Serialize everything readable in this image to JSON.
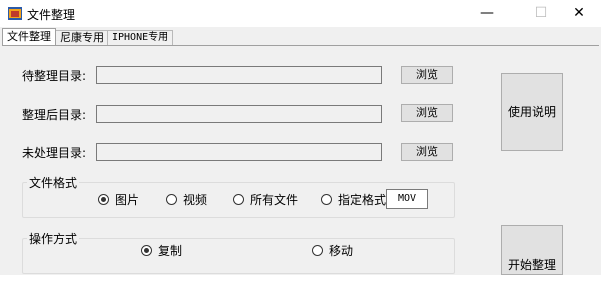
{
  "window": {
    "title": "文件整理",
    "controls": {
      "minimize": "—",
      "maximize": "☐",
      "close": "✕"
    }
  },
  "tabs": [
    {
      "label": "文件整理",
      "active": true
    },
    {
      "label": "尼康专用",
      "active": false
    },
    {
      "label": "IPHONE专用",
      "active": false
    }
  ],
  "dirs": {
    "source_label": "待整理目录:",
    "source_value": "",
    "dest_label": "整理后目录:",
    "dest_value": "",
    "unprocessed_label": "未处理目录:",
    "unprocessed_value": "",
    "browse_label": "浏览"
  },
  "help_button": "使用说明",
  "file_format": {
    "legend": "文件格式",
    "options": [
      "图片",
      "视频",
      "所有文件",
      "指定格式"
    ],
    "selected": "图片",
    "custom_value": "MOV"
  },
  "operation": {
    "legend": "操作方式",
    "options": [
      "复制",
      "移动"
    ],
    "selected": "复制"
  },
  "start_button": "开始整理",
  "colors": {
    "client_bg": "#f0f0f0",
    "button_bg": "#e1e1e1",
    "border": "#adadad"
  }
}
